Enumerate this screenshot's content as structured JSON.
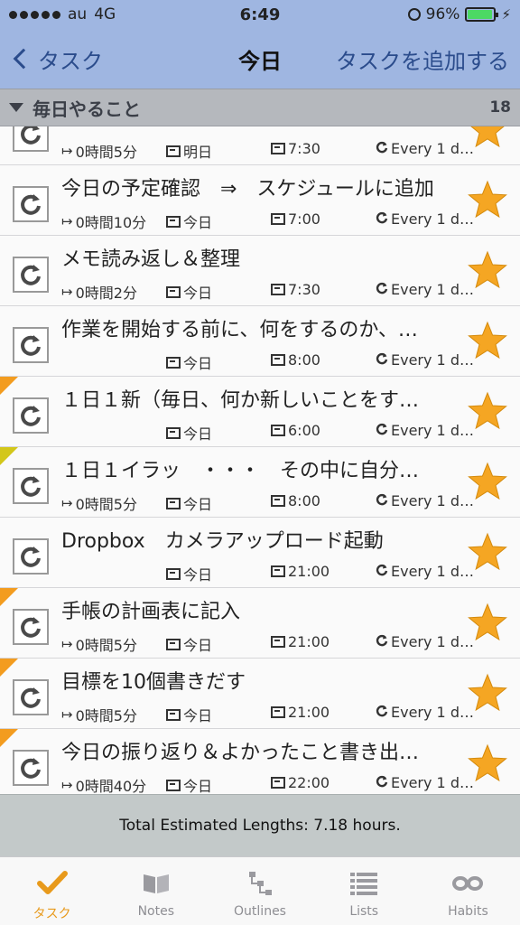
{
  "status_bar": {
    "carrier": "au",
    "network": "4G",
    "time": "6:49",
    "battery": "96%",
    "battery_level": 0.96
  },
  "nav": {
    "back_label": "タスク",
    "title": "今日",
    "add_label": "タスクを追加する"
  },
  "section": {
    "title": "毎日やること",
    "count": "18"
  },
  "rows": [
    {
      "title": "",
      "est": "0時間5分",
      "day": "明日",
      "time": "7:30",
      "repeat": "Every 1 d…",
      "corner": ""
    },
    {
      "title": "今日の予定確認　⇒　スケジュールに追加",
      "est": "0時間10分",
      "day": "今日",
      "time": "7:00",
      "repeat": "Every 1 d…",
      "corner": ""
    },
    {
      "title": "メモ読み返し＆整理",
      "est": "0時間2分",
      "day": "今日",
      "time": "7:30",
      "repeat": "Every 1 d…",
      "corner": ""
    },
    {
      "title": "作業を開始する前に、何をするのか、…",
      "est": "",
      "day": "今日",
      "time": "8:00",
      "repeat": "Every 1 d…",
      "corner": ""
    },
    {
      "title": "１日１新（毎日、何か新しいことをす…",
      "est": "",
      "day": "今日",
      "time": "6:00",
      "repeat": "Every 1 d…",
      "corner": "#f39c1f"
    },
    {
      "title": "１日１イラッ　・・・　その中に自分…",
      "est": "0時間5分",
      "day": "今日",
      "time": "8:00",
      "repeat": "Every 1 d…",
      "corner": "#d3c71a"
    },
    {
      "title": "Dropbox　カメラアップロード起動",
      "est": "",
      "day": "今日",
      "time": "21:00",
      "repeat": "Every 1 d…",
      "corner": ""
    },
    {
      "title": "手帳の計画表に記入",
      "est": "0時間5分",
      "day": "今日",
      "time": "21:00",
      "repeat": "Every 1 d…",
      "corner": "#f39c1f"
    },
    {
      "title": "目標を10個書きだす",
      "est": "0時間5分",
      "day": "今日",
      "time": "21:00",
      "repeat": "Every 1 d…",
      "corner": "#f39c1f"
    },
    {
      "title": "今日の振り返り＆よかったこと書き出…",
      "est": "0時間40分",
      "day": "今日",
      "time": "22:00",
      "repeat": "Every 1 d…",
      "corner": "#f39c1f"
    }
  ],
  "footer": {
    "total": "Total Estimated Lengths: 7.18 hours."
  },
  "tabs": [
    {
      "label": "タスク",
      "icon": "check-icon"
    },
    {
      "label": "Notes",
      "icon": "book-icon"
    },
    {
      "label": "Outlines",
      "icon": "outline-icon"
    },
    {
      "label": "Lists",
      "icon": "list-icon"
    },
    {
      "label": "Habits",
      "icon": "infinity-icon"
    }
  ],
  "colors": {
    "accent": "#e89a1c",
    "nav_bg": "#9fb6e1",
    "star": "#f5a623"
  }
}
